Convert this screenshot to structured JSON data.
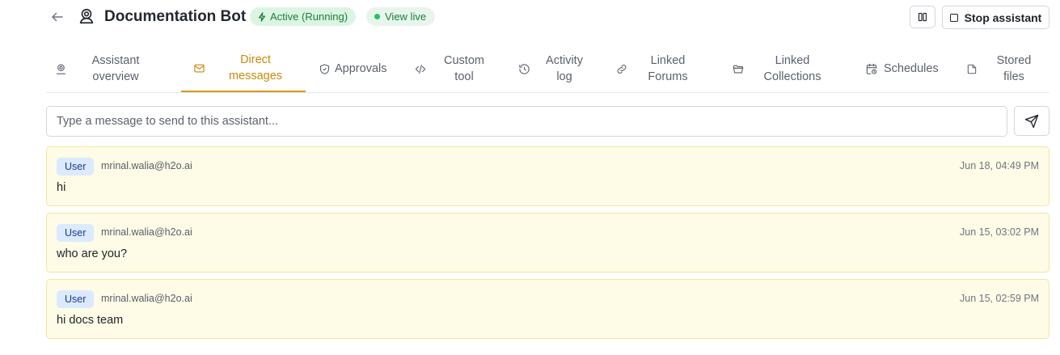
{
  "header": {
    "title": "Documentation Bot",
    "status_badge": "Active (Running)",
    "view_live": "View live",
    "stop_label": "Stop assistant"
  },
  "tabs": [
    {
      "id": "overview",
      "label": "Assistant overview",
      "icon": "robot-icon"
    },
    {
      "id": "direct-messages",
      "label": "Direct messages",
      "icon": "envelope-icon",
      "active": true
    },
    {
      "id": "approvals",
      "label": "Approvals",
      "icon": "shield-check-icon"
    },
    {
      "id": "custom-tool",
      "label": "Custom tool",
      "icon": "code-icon"
    },
    {
      "id": "activity-log",
      "label": "Activity log",
      "icon": "history-icon"
    },
    {
      "id": "linked-forums",
      "label": "Linked Forums",
      "icon": "link-icon"
    },
    {
      "id": "linked-collections",
      "label": "Linked Collections",
      "icon": "folder-open-icon"
    },
    {
      "id": "schedules",
      "label": "Schedules",
      "icon": "calendar-clock-icon"
    },
    {
      "id": "stored-files",
      "label": "Stored files",
      "icon": "file-icon"
    }
  ],
  "composer": {
    "placeholder": "Type a message to send to this assistant..."
  },
  "messages": [
    {
      "role": "User",
      "email": "mrinal.walia@h2o.ai",
      "time": "Jun 18, 04:49 PM",
      "text": "hi"
    },
    {
      "role": "User",
      "email": "mrinal.walia@h2o.ai",
      "time": "Jun 15, 03:02 PM",
      "text": "who are you?"
    },
    {
      "role": "User",
      "email": "mrinal.walia@h2o.ai",
      "time": "Jun 15, 02:59 PM",
      "text": "hi docs team"
    }
  ],
  "colors": {
    "accent": "#d79b18",
    "active_badge_bg": "#dcf5e3",
    "active_badge_fg": "#1a7f37",
    "message_bg": "#fefbe6",
    "role_badge_bg": "#dbeafe"
  }
}
